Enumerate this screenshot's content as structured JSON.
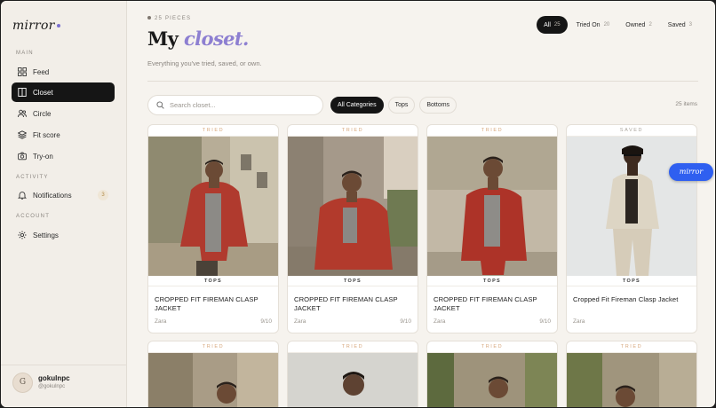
{
  "brand": {
    "name": "mirror"
  },
  "sidebar": {
    "section_main": "MAIN",
    "section_activity": "ACTIVITY",
    "section_account": "ACCOUNT",
    "items": [
      {
        "label": "Feed",
        "icon": "grid-icon"
      },
      {
        "label": "Closet",
        "icon": "wardrobe-icon",
        "active": true
      },
      {
        "label": "Circle",
        "icon": "people-icon"
      },
      {
        "label": "Fit score",
        "icon": "layers-icon"
      },
      {
        "label": "Try-on",
        "icon": "camera-icon"
      },
      {
        "label": "Notifications",
        "icon": "bell-icon",
        "badge": "3"
      },
      {
        "label": "Settings",
        "icon": "gear-icon"
      }
    ],
    "profile": {
      "initial": "G",
      "name": "gokulnpc",
      "handle": "@gokulnpc"
    }
  },
  "header": {
    "pieces_label": "25 PIECES",
    "title_main": "My ",
    "title_accent": "closet.",
    "subtitle": "Everything you've tried, saved, or own."
  },
  "tabs": [
    {
      "label": "All",
      "count": "25",
      "active": true
    },
    {
      "label": "Tried On",
      "count": "20"
    },
    {
      "label": "Owned",
      "count": "2"
    },
    {
      "label": "Saved",
      "count": "3"
    }
  ],
  "search": {
    "placeholder": "Search closet..."
  },
  "filters": [
    {
      "label": "All Categories",
      "active": true
    },
    {
      "label": "Tops"
    },
    {
      "label": "Bottoms"
    }
  ],
  "items_count": "25 items",
  "cards": [
    {
      "status": "TRIED",
      "category": "TOPS",
      "name": "CROPPED FIT FIREMAN CLASP JACKET",
      "brand": "Zara",
      "score": "9/10"
    },
    {
      "status": "TRIED",
      "category": "TOPS",
      "name": "CROPPED FIT FIREMAN CLASP JACKET",
      "brand": "Zara",
      "score": "9/10"
    },
    {
      "status": "TRIED",
      "category": "TOPS",
      "name": "CROPPED FIT FIREMAN CLASP JACKET",
      "brand": "Zara",
      "score": "9/10"
    },
    {
      "status": "SAVED",
      "category": "TOPS",
      "name": "Cropped Fit Fireman Clasp Jacket",
      "brand": "Zara",
      "score": ""
    },
    {
      "status": "TRIED"
    },
    {
      "status": "TRIED"
    },
    {
      "status": "TRIED"
    },
    {
      "status": "TRIED"
    }
  ],
  "colors": {
    "accent": "#8d7fd1",
    "tried": "#d7a87e",
    "saved": "#a9a49c",
    "float": "#2f5ff0"
  },
  "floating": {
    "label": "mirror"
  }
}
